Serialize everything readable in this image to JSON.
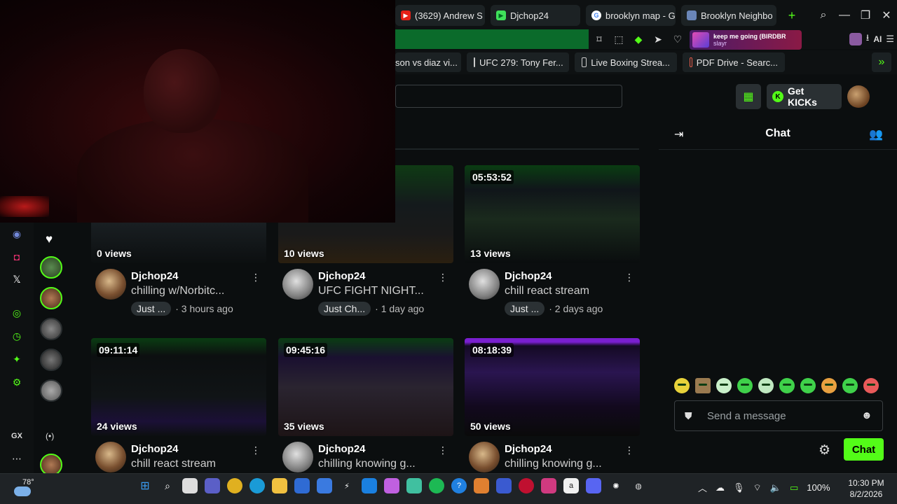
{
  "browser": {
    "tabs": [
      {
        "label": "(3629) Andrew S",
        "icon": "youtube-icon"
      },
      {
        "label": "Djchop24",
        "icon": "kick-icon"
      },
      {
        "label": "brooklyn map - G",
        "icon": "google-icon"
      },
      {
        "label": "Brooklyn Neighbo",
        "icon": "page-icon"
      }
    ],
    "new_tab": "+",
    "music": {
      "title": "keep me going (BIRDBR",
      "artist": "slayr"
    },
    "ai_label": "AI",
    "bookmarks": [
      {
        "label": "son vs diaz vi..."
      },
      {
        "label": "UFC 279: Tony Fer..."
      },
      {
        "label": "Live Boxing Strea..."
      },
      {
        "label": "PDF Drive - Searc..."
      }
    ]
  },
  "header": {
    "get_kicks": "Get KICKs"
  },
  "videos": [
    {
      "duration": "",
      "views": "0 views",
      "channel": "Djchop24",
      "title": "chilling w/Norbitc...",
      "tag": "Just ...",
      "time": "· 3 hours ago",
      "thumb": "dark-stream"
    },
    {
      "duration": "",
      "views": "10 views",
      "channel": "Djchop24",
      "title": "UFC FIGHT NIGHT...",
      "tag": "Just Ch...",
      "time": "· 1 day ago",
      "thumb": "ufc-stream"
    },
    {
      "duration": "05:53:52",
      "views": "13 views",
      "channel": "Djchop24",
      "title": "chill react stream",
      "tag": "Just ...",
      "time": "· 2 days ago",
      "thumb": "green-stream"
    },
    {
      "duration": "09:11:14",
      "views": "24 views",
      "channel": "Djchop24",
      "title": "chill react stream",
      "tag": "",
      "time": "",
      "thumb": "dark-stream"
    },
    {
      "duration": "09:45:16",
      "views": "35 views",
      "channel": "Djchop24",
      "title": "chilling knowing g...",
      "tag": "",
      "time": "",
      "thumb": "news-stream"
    },
    {
      "duration": "08:18:39",
      "views": "50 views",
      "channel": "Djchop24",
      "title": "chilling knowing g...",
      "tag": "",
      "time": "",
      "thumb": "purple-stream"
    }
  ],
  "chat": {
    "title": "Chat",
    "placeholder": "Send a message",
    "button": "Chat"
  },
  "taskbar": {
    "temp": "78°",
    "battery": "100%",
    "time": "10:30 PM",
    "date": "8/2/2026"
  },
  "colors": {
    "accent": "#53fc18",
    "background": "#0b0e0f"
  }
}
